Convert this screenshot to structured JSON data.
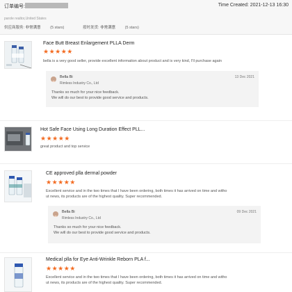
{
  "header": {
    "order_label": "订单编号:",
    "time_created": "Time Created: 2021-12-13 16:30",
    "buyer_line": "parole realtor,United States",
    "ratings": [
      {
        "label": "供应商服务:",
        "value": "非常满意",
        "stars": "(5 stars)"
      },
      {
        "label": "按时发货:",
        "value": "非常满意",
        "stars": "(5 stars)"
      }
    ]
  },
  "reviews": [
    {
      "title": "Face Butt Breast Enlargement PLLA Derm",
      "stars": "★★★★★",
      "rating": 5,
      "text": "bella is a very good seller, provide excellent information about product and is very kind, I'll purchase again",
      "reply": {
        "seller": "Bella Bi",
        "company": "Rimless Industry Co., Ltd",
        "date": "13 Dec 2021",
        "line1": "Thanks so much for your nice feedback.",
        "line2": "We will do our best to provide good service and products."
      }
    },
    {
      "title": "Hot Safe Face Using Long Duration Effect PLL...",
      "stars": "★★★★★",
      "rating": 5,
      "text": "great product and top service"
    },
    {
      "title": "CE approved plla dermal powder",
      "stars": "★★★★★",
      "rating": 5,
      "text_line1": "Excellent service and in the two times that I have been ordering, both times it has arrived on time and witho",
      "text_line2": "ut news, its products are of the highest quality.  Super recommended.",
      "reply": {
        "seller": "Bella Bi",
        "company": "Rimless Industry Co., Ltd",
        "date": "09 Dec 2021",
        "line1": "Thanks so much for your nice feedback.",
        "line2": "We will do our best to provide good service and products."
      }
    },
    {
      "title": "Medical plla for Eye Anti-Wrinkle Reborn PLA f...",
      "stars": "★★★★★",
      "rating": 5,
      "text_line1": "Excellent service and in the two times that I have been ordering, both times it has arrived on time and witho",
      "text_line2": "ut news, its products are of the highest quality.  Super recommended."
    }
  ],
  "colors": {
    "star": "#f36b21",
    "header_bg": "#f7f7f7",
    "reply_bg": "#f3f3f3"
  }
}
